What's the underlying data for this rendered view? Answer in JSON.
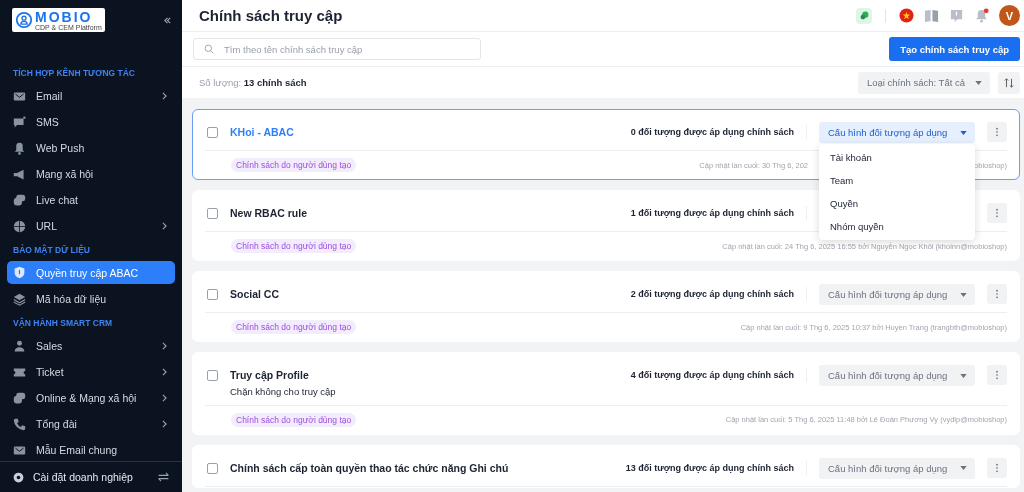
{
  "sidebar": {
    "logo": {
      "name": "MOBIO",
      "tagline": "CDP & CEM Platform"
    },
    "sections": [
      {
        "title": "TÍCH HỢP KÊNH TƯƠNG TÁC",
        "items": [
          {
            "label": "Email",
            "expandable": true,
            "selected": false
          },
          {
            "label": "SMS",
            "expandable": false,
            "selected": false
          },
          {
            "label": "Web Push",
            "expandable": false,
            "selected": false
          },
          {
            "label": "Mạng xã hội",
            "expandable": false,
            "selected": false
          },
          {
            "label": "Live chat",
            "expandable": false,
            "selected": false
          },
          {
            "label": "URL",
            "expandable": true,
            "selected": false
          }
        ]
      },
      {
        "title": "BẢO MẬT DỮ LIỆU",
        "items": [
          {
            "label": "Quyền truy cập ABAC",
            "expandable": false,
            "selected": true
          },
          {
            "label": "Mã hóa dữ liệu",
            "expandable": false,
            "selected": false
          }
        ]
      },
      {
        "title": "VẬN HÀNH SMART CRM",
        "items": [
          {
            "label": "Sales",
            "expandable": true,
            "selected": false
          },
          {
            "label": "Ticket",
            "expandable": true,
            "selected": false
          },
          {
            "label": "Online & Mạng xã hội",
            "expandable": true,
            "selected": false
          },
          {
            "label": "Tổng đài",
            "expandable": true,
            "selected": false
          },
          {
            "label": "Mẫu Email chung",
            "expandable": false,
            "selected": false
          }
        ]
      }
    ],
    "footer": {
      "label": "Cài đặt doanh nghiệp"
    }
  },
  "header": {
    "title": "Chính sách truy cập",
    "avatar": "V",
    "has_notification": true
  },
  "toolbar": {
    "search": {
      "placeholder": "Tìm theo tên chính sách truy cập"
    },
    "create_button": "Tạo chính sách truy cập"
  },
  "summary": {
    "label": "Số lượng:",
    "count": "13 chính sách",
    "filter": "Loại chính sách: Tất cả"
  },
  "policies": [
    {
      "name": "KHoi - ABAC",
      "active": true,
      "checked": false,
      "applied": "0 đối tượng được áp dụng chính sách",
      "config": {
        "label": "Cấu hình đối tượng áp dụng",
        "expanded": true,
        "menu": [
          "Tài khoản",
          "Team",
          "Quyền",
          "Nhóm quyền"
        ]
      },
      "tag": "Chính sách do người dùng tạo",
      "updated": "Cập nhật lần cuối: 30 Thg 6, 202",
      "updated_tail": "obioshop)"
    },
    {
      "name": "New RBAC rule",
      "active": false,
      "checked": false,
      "applied": "1 đối tượng được áp dụng chính sách",
      "tag": "Chính sách do người dùng tạo",
      "updated": "Cập nhật lần cuối: 24 Thg 6, 2025 16:55 bởi Nguyễn Ngọc Khôi (khoinn@mobioshop)"
    },
    {
      "name": "Social CC",
      "active": false,
      "checked": false,
      "applied": "2 đối tượng được áp dụng chính sách",
      "config": {
        "label": "Cấu hình đối tượng áp dụng",
        "expanded": false
      },
      "tag": "Chính sách do người dùng tạo",
      "updated": "Cập nhật lần cuối: 9 Thg 6, 2025 10:37 bởi Huyền Trang (trangbth@mobioshop)"
    },
    {
      "name": "Truy cập Profile",
      "active": false,
      "checked": false,
      "description": "Chặn không cho truy cập",
      "applied": "4 đối tượng được áp dụng chính sách",
      "config": {
        "label": "Cấu hình đối tượng áp dụng",
        "expanded": false
      },
      "tag": "Chính sách do người dùng tạo",
      "updated": "Cập nhật lần cuối: 5 Thg 6, 2025 11:48 bởi Lê Đoàn Phương Vy (vydlp@mobioshop)"
    },
    {
      "name": "Chính sách cấp toàn quyền thao tác chức năng Ghi chú",
      "active": false,
      "checked": false,
      "applied": "13 đối tượng được áp dụng chính sách",
      "config": {
        "label": "Cấu hình đối tượng áp dụng",
        "expanded": false
      }
    }
  ]
}
